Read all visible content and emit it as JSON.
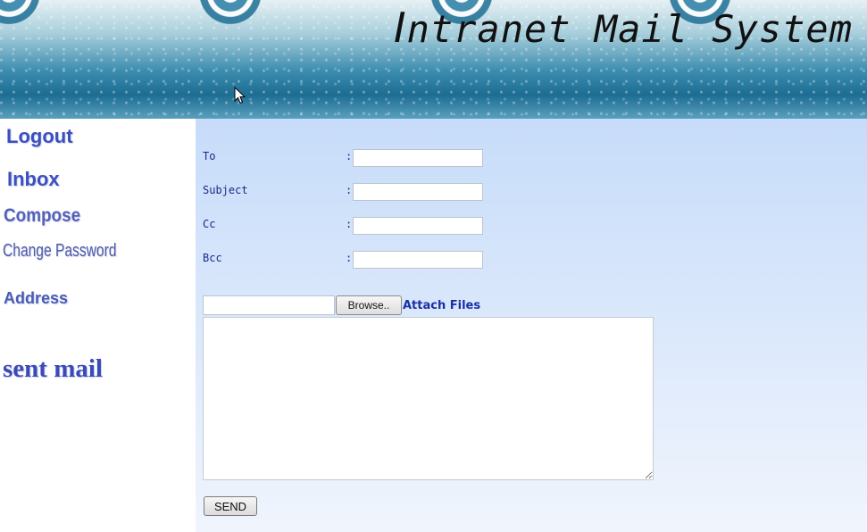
{
  "header": {
    "title_initial": "I",
    "title_rest": "ntranet Mail System"
  },
  "sidebar": {
    "items": [
      {
        "label": "Logout"
      },
      {
        "label": "Inbox"
      },
      {
        "label": "Compose"
      },
      {
        "label": "Change Password"
      },
      {
        "label": "Address"
      },
      {
        "label": "sent mail"
      }
    ]
  },
  "compose": {
    "fields": [
      {
        "label": "To",
        "value": ""
      },
      {
        "label": "Subject",
        "value": ""
      },
      {
        "label": "Cc",
        "value": ""
      },
      {
        "label": "Bcc",
        "value": ""
      }
    ],
    "separator": ":",
    "file_path_value": "",
    "browse_label": "Browse..",
    "attach_label": "Attach Files",
    "body_value": "",
    "send_label": "SEND"
  },
  "colors": {
    "nav_link": "#3b4fbf",
    "field_label": "#1a2a8c",
    "attach_label": "#1c2fa6",
    "panel_top": "#c7dcfa",
    "panel_bottom": "#f0f5fd",
    "banner_dark": "#1d6d93"
  }
}
